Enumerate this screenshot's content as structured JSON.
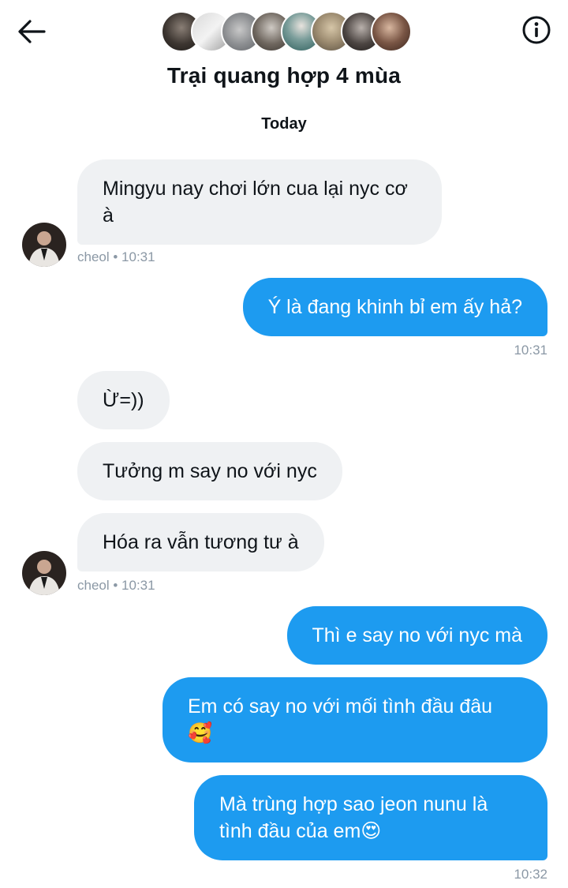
{
  "header": {
    "title": "Trại quang hợp 4 mùa",
    "back_icon": "arrow-left-icon",
    "info_icon": "info-circle-icon",
    "member_avatar_count": 8
  },
  "date_separator": "Today",
  "messages": [
    {
      "side": "in",
      "text": "Mingyu nay chơi lớn cua lại nyc cơ à"
    },
    {
      "side": "out",
      "text": "Ý là đang khinh bỉ em ấy hả?"
    },
    {
      "side": "in",
      "text": "Ừ=))"
    },
    {
      "side": "in",
      "text": "Tưởng m say no với nyc"
    },
    {
      "side": "in",
      "text": "Hóa ra vẫn tương tư à"
    },
    {
      "side": "out",
      "text": "Thì e say no với nyc mà"
    },
    {
      "side": "out",
      "text": "Em có say no với mối tình đầu đâu 🥰"
    },
    {
      "side": "out",
      "text": "Mà trùng hợp sao jeon nunu là tình đầu của em😍"
    }
  ],
  "meta": {
    "msg1": "cheol • 10:31",
    "msg2": "10:31",
    "msg5": "cheol • 10:31",
    "msg8": "10:32"
  },
  "colors": {
    "outgoing_bubble": "#1d9bf0",
    "incoming_bubble": "#eff1f3",
    "meta_text": "#8b98a5"
  }
}
